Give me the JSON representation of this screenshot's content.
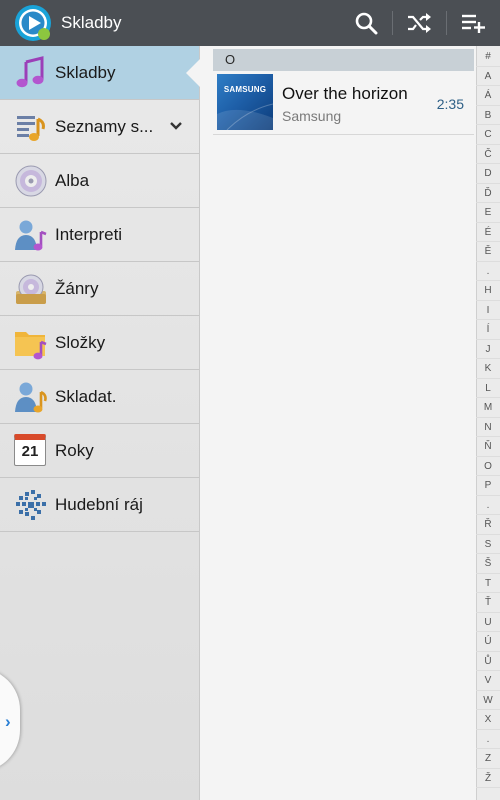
{
  "header": {
    "title": "Skladby"
  },
  "sidebar": {
    "items": [
      {
        "label": "Skladby",
        "icon": "music-note-icon"
      },
      {
        "label": "Seznamy s...",
        "icon": "playlist-icon"
      },
      {
        "label": "Alba",
        "icon": "album-disc-icon"
      },
      {
        "label": "Interpreti",
        "icon": "artist-icon"
      },
      {
        "label": "Žánry",
        "icon": "genre-icon"
      },
      {
        "label": "Složky",
        "icon": "folder-icon"
      },
      {
        "label": "Skladat.",
        "icon": "composer-icon"
      },
      {
        "label": "Roky",
        "icon": "calendar-icon"
      },
      {
        "label": "Hudební ráj",
        "icon": "music-square-icon"
      }
    ],
    "calendar_day": "21"
  },
  "content": {
    "section_letter": "O",
    "songs": [
      {
        "title": "Over the horizon",
        "artist": "Samsung",
        "duration": "2:35",
        "art_label": "SAMSUNG"
      }
    ]
  },
  "index": [
    "#",
    "A",
    "Á",
    "B",
    "C",
    "Č",
    "D",
    "Ď",
    "E",
    "É",
    "Ě",
    ".",
    "H",
    "I",
    "Í",
    "J",
    "K",
    "L",
    "M",
    "N",
    "Ň",
    "O",
    "P",
    ".",
    "Ř",
    "S",
    "Š",
    "T",
    "Ť",
    "U",
    "Ú",
    "Ů",
    "V",
    "W",
    "X",
    ".",
    "Z",
    "Ž"
  ],
  "colors": {
    "actionbar": "#4b4f54",
    "active_item": "#b0d1e3",
    "accent_blue": "#2a7fd4",
    "duration_text": "#2d5f86"
  }
}
